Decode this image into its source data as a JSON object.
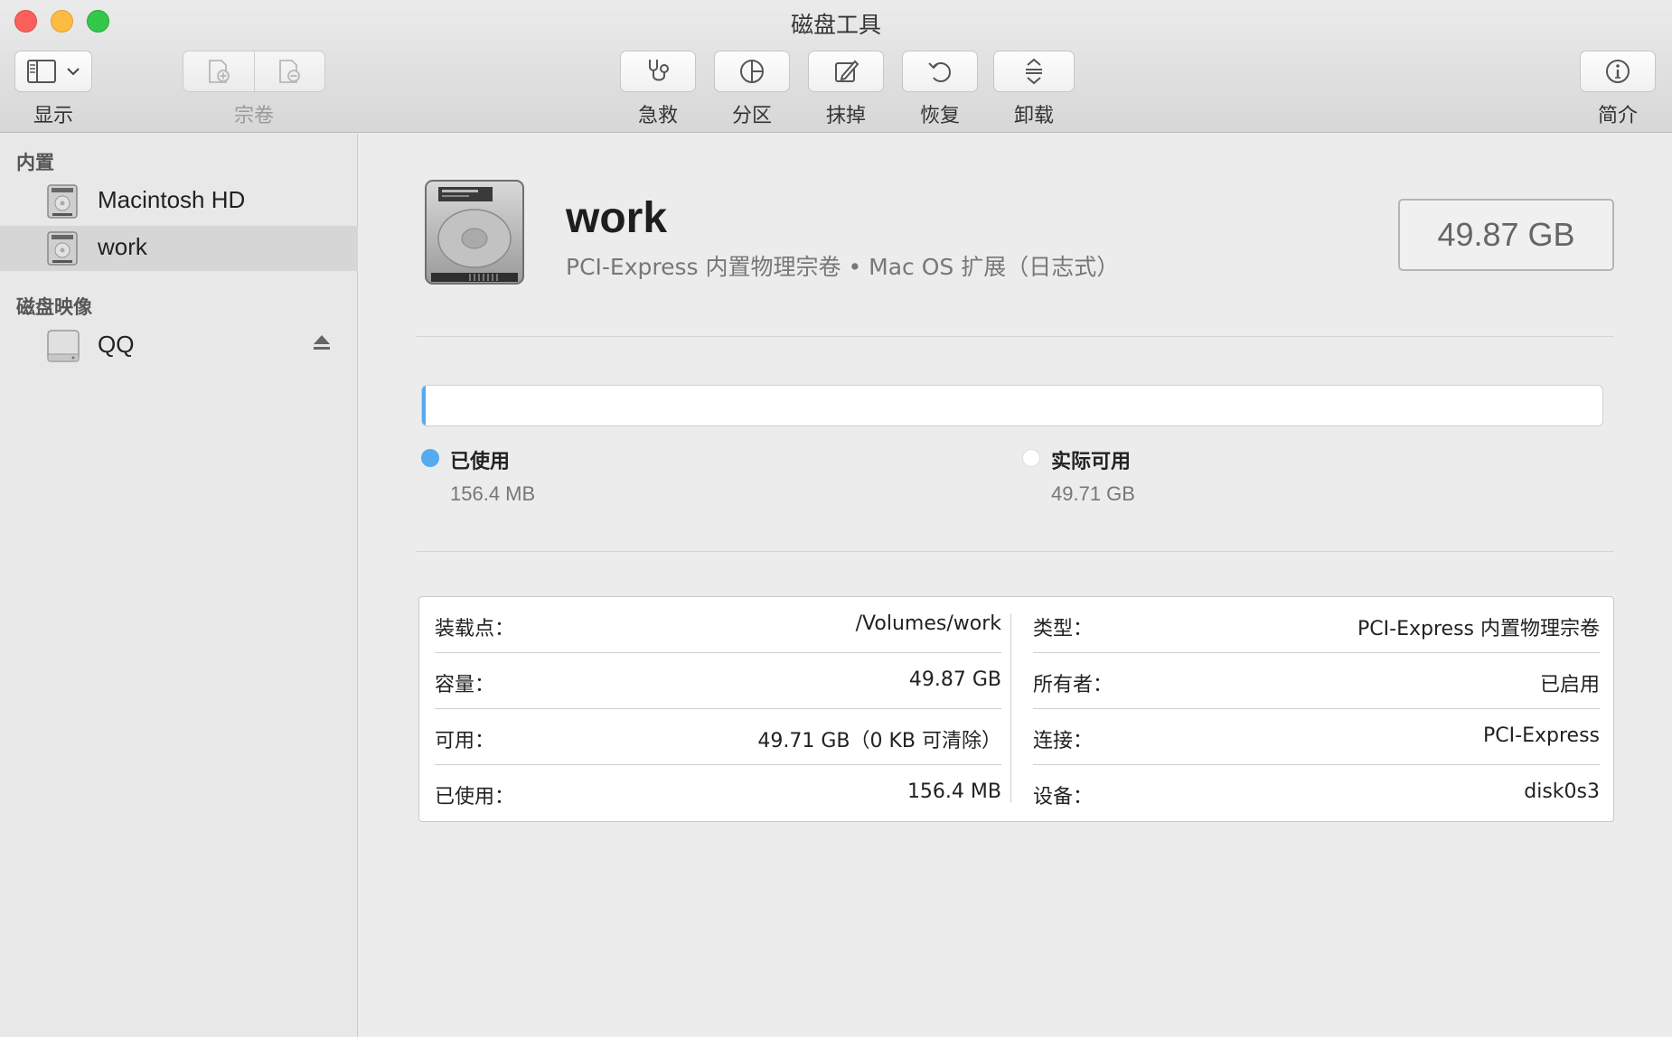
{
  "window": {
    "title": "磁盘工具"
  },
  "toolbar": {
    "view_label": "显示",
    "volume_label": "宗卷",
    "first_aid_label": "急救",
    "partition_label": "分区",
    "erase_label": "抹掉",
    "restore_label": "恢复",
    "unmount_label": "卸载",
    "info_label": "简介"
  },
  "sidebar": {
    "internal_header": "内置",
    "internal_items": [
      {
        "label": "Macintosh HD",
        "selected": false
      },
      {
        "label": "work",
        "selected": true
      }
    ],
    "images_header": "磁盘映像",
    "image_items": [
      {
        "label": "QQ",
        "ejectable": true
      }
    ]
  },
  "volume": {
    "name": "work",
    "subtitle": "PCI-Express 内置物理宗卷 • Mac OS 扩展（日志式）",
    "size": "49.87 GB"
  },
  "usage": {
    "used_fraction": 0.003,
    "used_color": "#55aaf0",
    "free_color": "#ffffff",
    "used_label": "已使用",
    "used_value": "156.4 MB",
    "free_label": "实际可用",
    "free_value": "49.71 GB"
  },
  "info": {
    "left": [
      {
        "key": "装载点：",
        "value": "/Volumes/work"
      },
      {
        "key": "容量：",
        "value": "49.87 GB"
      },
      {
        "key": "可用：",
        "value": "49.71 GB（0 KB 可清除）"
      },
      {
        "key": "已使用：",
        "value": "156.4 MB"
      }
    ],
    "right": [
      {
        "key": "类型：",
        "value": "PCI-Express 内置物理宗卷"
      },
      {
        "key": "所有者：",
        "value": "已启用"
      },
      {
        "key": "连接：",
        "value": "PCI-Express"
      },
      {
        "key": "设备：",
        "value": "disk0s3"
      }
    ]
  }
}
